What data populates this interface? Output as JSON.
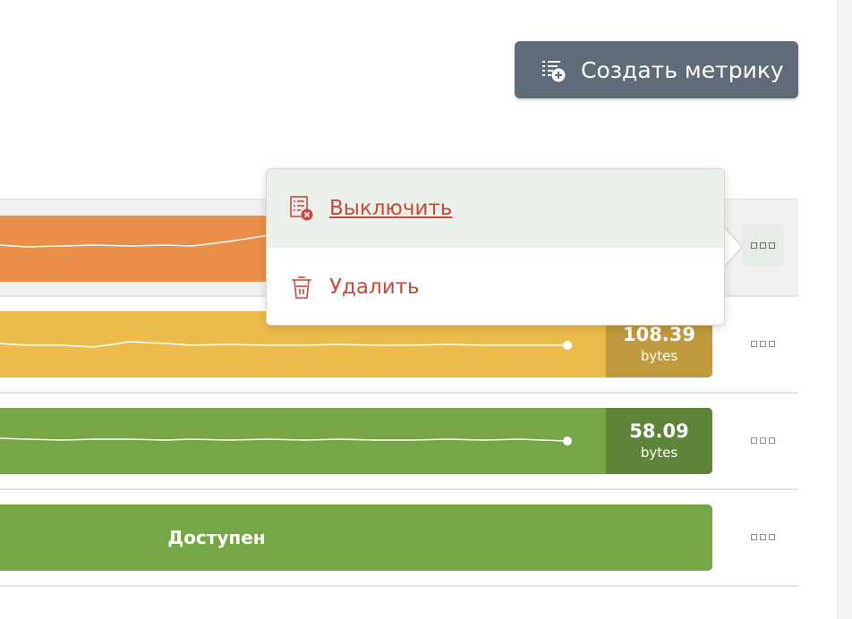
{
  "toolbar": {
    "create_label": "Создать метрику",
    "create_icon": "list-plus-icon"
  },
  "context_menu": {
    "items": [
      {
        "label": "Выключить",
        "icon": "list-disable-icon"
      },
      {
        "label": "Удалить",
        "icon": "trash-icon"
      }
    ]
  },
  "metrics": [
    {
      "color": "#ea8f4a",
      "value": "",
      "unit": ""
    },
    {
      "color": "#ecbb4c",
      "value_color": "#c09a3d",
      "value": "108.39",
      "unit": "bytes"
    },
    {
      "color": "#76a646",
      "value_color": "#5d8438",
      "value": "58.09",
      "unit": "bytes"
    },
    {
      "color": "#76a646",
      "status": "Доступен"
    }
  ],
  "colors": {
    "accent_danger": "#c8483c",
    "button_bg": "#5f6b78"
  }
}
